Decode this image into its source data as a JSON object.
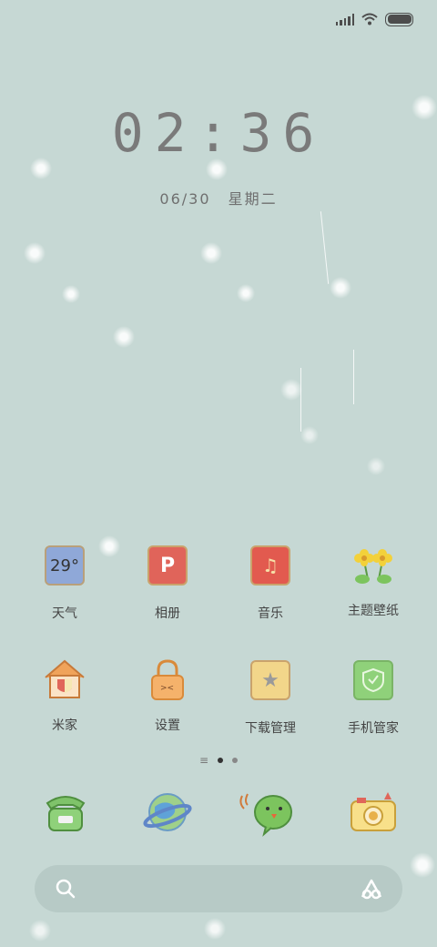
{
  "status_bar": {
    "signal_icon": "signal-bars-icon",
    "wifi_icon": "wifi-icon",
    "battery_icon": "battery-icon"
  },
  "lockscreen": {
    "time": "02:36",
    "date": "06/30",
    "weekday": "星期二"
  },
  "apps": [
    {
      "label": "天气",
      "icon": "weather-icon",
      "icon_text": "29°"
    },
    {
      "label": "相册",
      "icon": "photo-album-icon",
      "icon_text": "P"
    },
    {
      "label": "音乐",
      "icon": "music-icon"
    },
    {
      "label": "主题壁纸",
      "icon": "flowers-theme-icon"
    },
    {
      "label": "米家",
      "icon": "house-icon"
    },
    {
      "label": "设置",
      "icon": "lock-settings-icon"
    },
    {
      "label": "下载管理",
      "icon": "star-folder-icon"
    },
    {
      "label": "手机管家",
      "icon": "shield-icon"
    }
  ],
  "page_indicator": {
    "pages": 2,
    "active": 0
  },
  "dock": [
    {
      "icon": "phone-icon"
    },
    {
      "icon": "browser-planet-icon"
    },
    {
      "icon": "message-bird-icon"
    },
    {
      "icon": "camera-icon"
    }
  ],
  "search_bar": {
    "search_icon": "search-icon",
    "assistant_icon": "assistant-icon"
  },
  "colors": {
    "wallpaper": "#c6d8d4",
    "text": "#444444"
  }
}
